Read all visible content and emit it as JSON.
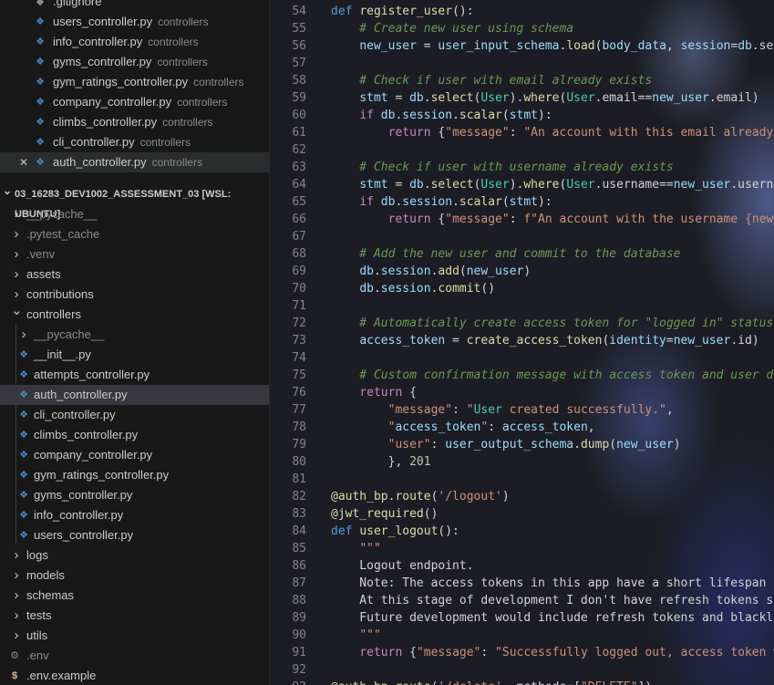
{
  "colors": {
    "accent": "#4a89c7",
    "sidebar_bg": "#181818",
    "editor_bg": "#1c1d24"
  },
  "open_editors": [
    {
      "name": ".gitignore",
      "desc": "",
      "icon": "gear-icon"
    },
    {
      "name": "users_controller.py",
      "desc": "controllers",
      "icon": "python-icon"
    },
    {
      "name": "info_controller.py",
      "desc": "controllers",
      "icon": "python-icon"
    },
    {
      "name": "gyms_controller.py",
      "desc": "controllers",
      "icon": "python-icon"
    },
    {
      "name": "gym_ratings_controller.py",
      "desc": "controllers",
      "icon": "python-icon"
    },
    {
      "name": "company_controller.py",
      "desc": "controllers",
      "icon": "python-icon"
    },
    {
      "name": "climbs_controller.py",
      "desc": "controllers",
      "icon": "python-icon"
    },
    {
      "name": "cli_controller.py",
      "desc": "controllers",
      "icon": "python-icon"
    },
    {
      "name": "auth_controller.py",
      "desc": "controllers",
      "icon": "python-icon"
    }
  ],
  "explorer": {
    "section_title": "03_16283_DEV1002_ASSESSMENT_03 [WSL: UBUNTU]",
    "items": [
      {
        "name": "__pycache__",
        "type": "folder"
      },
      {
        "name": ".pytest_cache",
        "type": "folder"
      },
      {
        "name": ".venv",
        "type": "folder"
      },
      {
        "name": "assets",
        "type": "folder"
      },
      {
        "name": "contributions",
        "type": "folder"
      },
      {
        "name": "controllers",
        "type": "folder-open"
      },
      {
        "name": "__pycache__",
        "type": "subfolder"
      },
      {
        "name": "__init__.py",
        "type": "file"
      },
      {
        "name": "attempts_controller.py",
        "type": "file"
      },
      {
        "name": "auth_controller.py",
        "type": "file"
      },
      {
        "name": "cli_controller.py",
        "type": "file"
      },
      {
        "name": "climbs_controller.py",
        "type": "file"
      },
      {
        "name": "company_controller.py",
        "type": "file"
      },
      {
        "name": "gym_ratings_controller.py",
        "type": "file"
      },
      {
        "name": "gyms_controller.py",
        "type": "file"
      },
      {
        "name": "info_controller.py",
        "type": "file"
      },
      {
        "name": "users_controller.py",
        "type": "file"
      },
      {
        "name": "logs",
        "type": "folder"
      },
      {
        "name": "models",
        "type": "folder"
      },
      {
        "name": "schemas",
        "type": "folder"
      },
      {
        "name": "tests",
        "type": "folder"
      },
      {
        "name": "utils",
        "type": "folder"
      },
      {
        "name": ".env",
        "type": "gear"
      },
      {
        "name": ".env.example",
        "type": "dollar"
      }
    ]
  },
  "code": [
    {
      "n": "54",
      "t": "def register_user():"
    },
    {
      "n": "55",
      "t": "    # Create new user using schema"
    },
    {
      "n": "56",
      "t": "    new_user = user_input_schema.load(body_data, session=db.ses"
    },
    {
      "n": "57",
      "t": ""
    },
    {
      "n": "58",
      "t": "    # Check if user with email already exists"
    },
    {
      "n": "59",
      "t": "    stmt = db.select(User).where(User.email==new_user.email)"
    },
    {
      "n": "60",
      "t": "    if db.session.scalar(stmt):"
    },
    {
      "n": "61",
      "t": "        return {\"message\": \"An account with this email already"
    },
    {
      "n": "62",
      "t": ""
    },
    {
      "n": "63",
      "t": "    # Check if user with username already exists"
    },
    {
      "n": "64",
      "t": "    stmt = db.select(User).where(User.username==new_user.userna"
    },
    {
      "n": "65",
      "t": "    if db.session.scalar(stmt):"
    },
    {
      "n": "66",
      "t": "        return {\"message\": f\"An account with the username {new_"
    },
    {
      "n": "67",
      "t": ""
    },
    {
      "n": "68",
      "t": "    # Add the new user and commit to the database"
    },
    {
      "n": "69",
      "t": "    db.session.add(new_user)"
    },
    {
      "n": "70",
      "t": "    db.session.commit()"
    },
    {
      "n": "71",
      "t": ""
    },
    {
      "n": "72",
      "t": "    # Automatically create access token for \"logged in\" status"
    },
    {
      "n": "73",
      "t": "    access_token = create_access_token(identity=new_user.id)"
    },
    {
      "n": "74",
      "t": ""
    },
    {
      "n": "75",
      "t": "    # Custom confirmation message with access token and user da"
    },
    {
      "n": "76",
      "t": "    return {"
    },
    {
      "n": "77",
      "t": "        \"message\": \"User created successfully.\","
    },
    {
      "n": "78",
      "t": "        \"access_token\": access_token,"
    },
    {
      "n": "79",
      "t": "        \"user\": user_output_schema.dump(new_user)"
    },
    {
      "n": "80",
      "t": "        }, 201"
    },
    {
      "n": "81",
      "t": ""
    },
    {
      "n": "82",
      "t": "@auth_bp.route('/logout')"
    },
    {
      "n": "83",
      "t": "@jwt_required()"
    },
    {
      "n": "84",
      "t": "def user_logout():"
    },
    {
      "n": "85",
      "t": "    \"\"\""
    },
    {
      "n": "86",
      "t": "    Logout endpoint."
    },
    {
      "n": "87",
      "t": "    Note: The access tokens in this app have a short lifespan o"
    },
    {
      "n": "88",
      "t": "    At this stage of development I don't have refresh tokens so"
    },
    {
      "n": "89",
      "t": "    Future development would include refresh tokens and blackli"
    },
    {
      "n": "90",
      "t": "    \"\"\""
    },
    {
      "n": "91",
      "t": "    return {\"message\": \"Successfully logged out, access token w"
    },
    {
      "n": "92",
      "t": ""
    },
    {
      "n": "93",
      "t": "@auth_bp.route('/delete', methods=[\"DELETE\"])"
    }
  ]
}
